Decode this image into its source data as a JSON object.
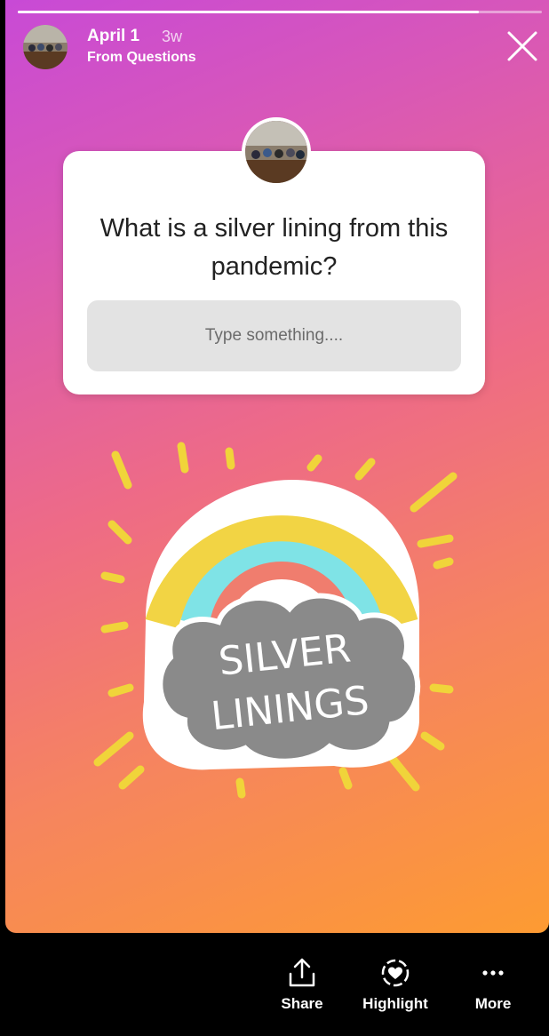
{
  "story": {
    "progress_fraction": 0.88,
    "date": "April 1",
    "ago": "3w",
    "source": "From Questions"
  },
  "question_sticker": {
    "question": "What is a silver lining from this pandemic?",
    "input_placeholder": "Type something...."
  },
  "art_sticker": {
    "line1": "SILVER",
    "line2": "LININGS"
  },
  "actions": [
    {
      "label": "Share",
      "icon": "share-icon"
    },
    {
      "label": "Highlight",
      "icon": "highlight-icon"
    },
    {
      "label": "More",
      "icon": "more-icon"
    }
  ]
}
